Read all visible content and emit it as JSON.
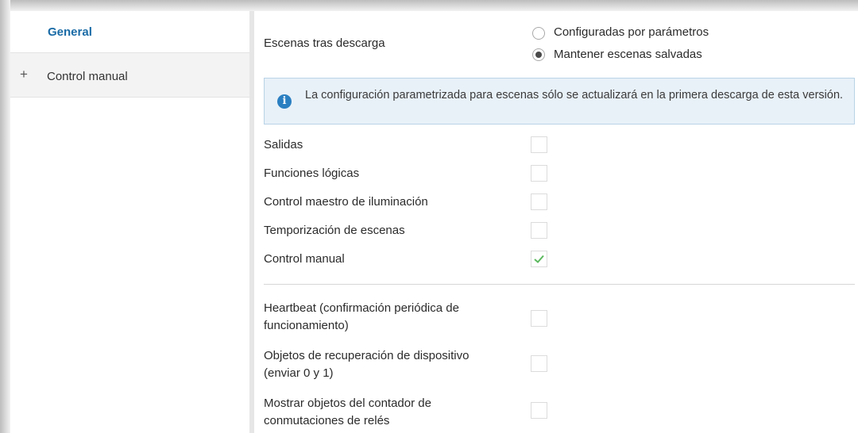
{
  "sidebar": {
    "items": [
      {
        "label": "General"
      },
      {
        "expander": "+",
        "label": "Control manual"
      }
    ]
  },
  "main": {
    "scenes": {
      "label": "Escenas tras descarga",
      "options": [
        {
          "label": "Configuradas por parámetros",
          "selected": false
        },
        {
          "label": "Mantener escenas salvadas",
          "selected": true
        }
      ]
    },
    "info": {
      "icon": "info-icon",
      "text": "La configuración parametrizada para escenas sólo se actualizará en la primera descarga de esta versión."
    },
    "checkboxes": [
      {
        "label": "Salidas",
        "checked": false
      },
      {
        "label": "Funciones lógicas",
        "checked": false
      },
      {
        "label": "Control maestro de iluminación",
        "checked": false
      },
      {
        "label": "Temporización de escenas",
        "checked": false
      },
      {
        "label": "Control manual",
        "checked": true
      }
    ],
    "extra_checkboxes": [
      {
        "label_line1": "Heartbeat (confirmación periódica de",
        "label_line2": "funcionamiento)",
        "checked": false
      },
      {
        "label_line1": "Objetos de recuperación de dispositivo",
        "label_line2": "(enviar 0 y 1)",
        "checked": false
      },
      {
        "label_line1": "Mostrar objetos del contador de",
        "label_line2": "conmutaciones de relés",
        "checked": false
      }
    ]
  },
  "colors": {
    "accent": "#1a6ba6",
    "info_bg": "#e8f1f8",
    "check": "#5bb85d"
  }
}
